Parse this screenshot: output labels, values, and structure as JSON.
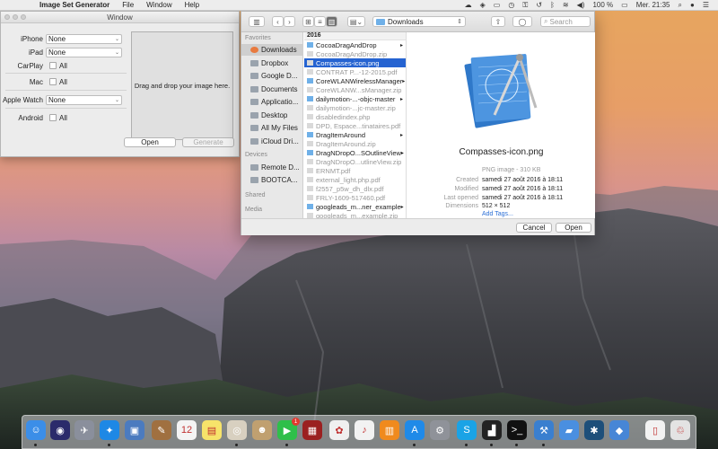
{
  "menubar": {
    "app_name": "Image Set Generator",
    "menus": [
      "File",
      "Window",
      "Help"
    ],
    "battery": "100 %",
    "clock": "Mer. 21:35"
  },
  "window1": {
    "title": "Window",
    "rows": [
      {
        "label": "iPhone",
        "type": "select",
        "value": "None"
      },
      {
        "label": "iPad",
        "type": "select",
        "value": "None"
      },
      {
        "label": "CarPlay",
        "type": "checkbox",
        "value": "All"
      },
      {
        "label": "Mac",
        "type": "checkbox",
        "value": "All"
      },
      {
        "label": "Apple Watch",
        "type": "select",
        "value": "None"
      },
      {
        "label": "Android",
        "type": "checkbox",
        "value": "All"
      }
    ],
    "dropzone_text": "Drag and drop your image here.",
    "open_label": "Open",
    "generate_label": "Generate"
  },
  "dialog": {
    "location": "Downloads",
    "search_placeholder": "Search",
    "sidebar": {
      "favorites_header": "Favorites",
      "favorites": [
        "Downloads",
        "Dropbox",
        "Google D...",
        "Documents",
        "Applicatio...",
        "Desktop",
        "All My Files",
        "iCloud Dri..."
      ],
      "devices_header": "Devices",
      "devices": [
        "Remote D...",
        "BOOTCA..."
      ],
      "shared_header": "Shared",
      "media_header": "Media"
    },
    "column_header": "2016",
    "files": [
      {
        "name": "CocoaDragAndDrop",
        "kind": "folder",
        "dim": false
      },
      {
        "name": "CocoaDragAndDrop.zip",
        "kind": "file",
        "dim": true
      },
      {
        "name": "Compasses-icon.png",
        "kind": "file",
        "dim": false,
        "selected": true
      },
      {
        "name": "CONTRAT P...-12-2015.pdf",
        "kind": "file",
        "dim": true
      },
      {
        "name": "CoreWLANWirelessManager",
        "kind": "folder",
        "dim": false
      },
      {
        "name": "CoreWLANW...sManager.zip",
        "kind": "file",
        "dim": true
      },
      {
        "name": "dailymotion-...-objc-master",
        "kind": "folder",
        "dim": false
      },
      {
        "name": "dailymotion-...jc-master.zip",
        "kind": "file",
        "dim": true
      },
      {
        "name": "disabledindex.php",
        "kind": "file",
        "dim": true
      },
      {
        "name": "DPD, Espace...tinataires.pdf",
        "kind": "file",
        "dim": true
      },
      {
        "name": "DragItemAround",
        "kind": "folder",
        "dim": false
      },
      {
        "name": "DragItemAround.zip",
        "kind": "file",
        "dim": true
      },
      {
        "name": "DragNDropO...SOutlineView",
        "kind": "folder",
        "dim": false
      },
      {
        "name": "DragNDropO...utlineView.zip",
        "kind": "file",
        "dim": true
      },
      {
        "name": "ERNMT.pdf",
        "kind": "file",
        "dim": true
      },
      {
        "name": "external_light.php.pdf",
        "kind": "file",
        "dim": true
      },
      {
        "name": "f2557_p5w_dh_dlx.pdf",
        "kind": "file",
        "dim": true
      },
      {
        "name": "FRLY-1609-517460.pdf",
        "kind": "file",
        "dim": true
      },
      {
        "name": "googleads_m...ner_example",
        "kind": "folder",
        "dim": false
      },
      {
        "name": "googleads_m...example.zip",
        "kind": "file",
        "dim": true
      }
    ],
    "preview": {
      "filename": "Compasses-icon.png",
      "info": [
        {
          "key": "",
          "value": "PNG image - 310 KB"
        },
        {
          "key": "Created",
          "value": "samedi 27 août 2016 à 18:11"
        },
        {
          "key": "Modified",
          "value": "samedi 27 août 2016 à 18:11"
        },
        {
          "key": "Last opened",
          "value": "samedi 27 août 2016 à 18:11"
        },
        {
          "key": "Dimensions",
          "value": "512 × 512"
        }
      ],
      "add_tags": "Add Tags..."
    },
    "cancel_label": "Cancel",
    "open_label": "Open"
  },
  "dock": {
    "apps": [
      {
        "name": "finder-icon",
        "color": "#3b8ee8",
        "glyph": "☺"
      },
      {
        "name": "siri-icon",
        "color": "#2b2b6b",
        "glyph": "◉"
      },
      {
        "name": "launchpad-icon",
        "color": "#8a8f9c",
        "glyph": "✈"
      },
      {
        "name": "safari-icon",
        "color": "#1e88e5",
        "glyph": "✦"
      },
      {
        "name": "preview-icon",
        "color": "#4b7bbf",
        "glyph": "▣"
      },
      {
        "name": "notes-icon",
        "color": "#a07040",
        "glyph": "✎"
      },
      {
        "name": "calendar-icon",
        "color": "#f4f4f4",
        "glyph": "12"
      },
      {
        "name": "stickies-icon",
        "color": "#f7e36a",
        "glyph": "▤"
      },
      {
        "name": "photos-preview-icon",
        "color": "#d8d0c0",
        "glyph": "◎"
      },
      {
        "name": "contacts-icon",
        "color": "#c0a070",
        "glyph": "☻"
      },
      {
        "name": "facetime-icon",
        "color": "#2fbf4a",
        "glyph": "▶"
      },
      {
        "name": "photo-booth-icon",
        "color": "#9b2020",
        "glyph": "▦"
      },
      {
        "name": "photos-icon",
        "color": "#f0f0f0",
        "glyph": "✿"
      },
      {
        "name": "itunes-icon",
        "color": "#f2f2f2",
        "glyph": "♪"
      },
      {
        "name": "ibooks-icon",
        "color": "#f08a1d",
        "glyph": "▥"
      },
      {
        "name": "app-store-icon",
        "color": "#1f8ae8",
        "glyph": "A"
      },
      {
        "name": "system-preferences-icon",
        "color": "#8f9299",
        "glyph": "⚙"
      },
      {
        "name": "skype-icon",
        "color": "#1aa3e6",
        "glyph": "S"
      },
      {
        "name": "activity-monitor-icon",
        "color": "#222",
        "glyph": "▟"
      },
      {
        "name": "terminal-icon",
        "color": "#111",
        "glyph": ">_"
      },
      {
        "name": "xcode-icon",
        "color": "#3a7fcf",
        "glyph": "⚒"
      },
      {
        "name": "folder-icon",
        "color": "#4a8fe0",
        "glyph": "▰"
      },
      {
        "name": "sourcetree-icon",
        "color": "#1d4f7a",
        "glyph": "✱"
      },
      {
        "name": "blue-app-icon",
        "color": "#4786d6",
        "glyph": "◆"
      },
      {
        "name": "document-icon",
        "color": "#f2f2f2",
        "glyph": "▯"
      },
      {
        "name": "trash-icon",
        "color": "#e3e3e3",
        "glyph": "♲"
      }
    ],
    "facetime_badge": "1"
  }
}
